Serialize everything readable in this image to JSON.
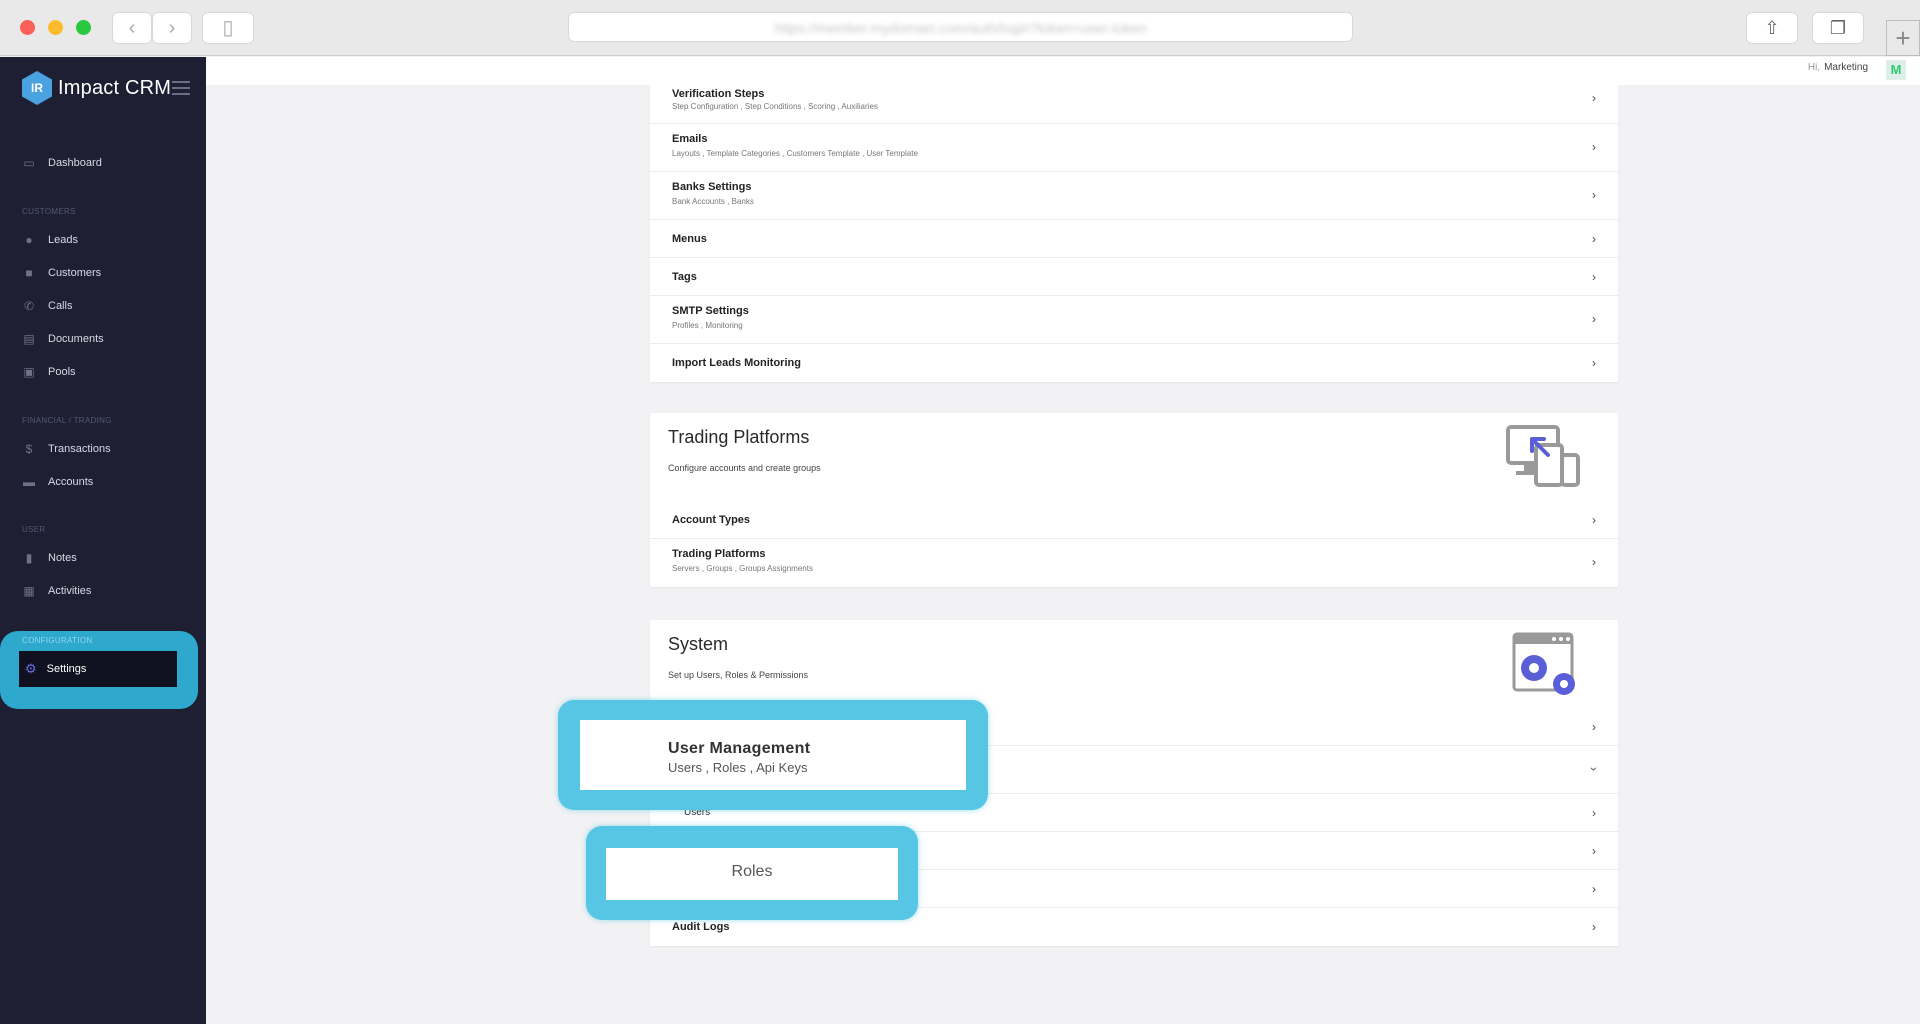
{
  "browser": {
    "url": "https://member.mydomain.com/auth/login?token=user-token"
  },
  "sidebar": {
    "brand": "Impact CRM",
    "logo_letters": "IR",
    "items": [
      {
        "label": "Dashboard",
        "icon": "monitor-icon"
      },
      {
        "label": "Leads",
        "icon": "user-icon"
      },
      {
        "label": "Customers",
        "icon": "contact-card-icon"
      },
      {
        "label": "Calls",
        "icon": "phone-icon"
      },
      {
        "label": "Documents",
        "icon": "inbox-icon"
      },
      {
        "label": "Pools",
        "icon": "briefcase-icon"
      },
      {
        "label": "Transactions",
        "icon": "dollar-icon"
      },
      {
        "label": "Accounts",
        "icon": "wallet-icon"
      },
      {
        "label": "Notes",
        "icon": "clipboard-icon"
      },
      {
        "label": "Activities",
        "icon": "calendar-icon"
      },
      {
        "label": "Settings",
        "icon": "gear-icon"
      }
    ],
    "sections": {
      "customers": "CUSTOMERS",
      "financial": "FINANCIAL / TRADING",
      "user": "USER",
      "configuration": "CONFIGURATION"
    }
  },
  "topbar": {
    "hi": "Hi,",
    "user": "Marketing",
    "avatar": "M"
  },
  "card1": {
    "rows": [
      {
        "title": "Verification Steps",
        "sub": "Step Configuration , Step Conditions , Scoring , Auxiliaries"
      },
      {
        "title": "Emails",
        "sub": "Layouts , Template Categories , Customers Template , User Template"
      },
      {
        "title": "Banks Settings",
        "sub": "Bank Accounts , Banks"
      },
      {
        "title": "Menus",
        "sub": ""
      },
      {
        "title": "Tags",
        "sub": ""
      },
      {
        "title": "SMTP Settings",
        "sub": "Profiles , Monitoring"
      },
      {
        "title": "Import Leads Monitoring",
        "sub": ""
      }
    ]
  },
  "trading": {
    "title": "Trading Platforms",
    "subtitle": "Configure accounts and create groups",
    "rows": [
      {
        "title": "Account Types",
        "sub": ""
      },
      {
        "title": "Trading Platforms",
        "sub": "Servers , Groups , Groups Assignments"
      }
    ]
  },
  "system": {
    "title": "System",
    "subtitle": "Set up Users, Roles & Permissions",
    "rows": [
      {
        "title": "",
        "sub": ""
      },
      {
        "title": "",
        "sub": ""
      },
      {
        "title": "Users",
        "sub": ""
      },
      {
        "title": "",
        "sub": ""
      },
      {
        "title": "",
        "sub": ""
      },
      {
        "title": "Audit Logs",
        "sub": ""
      }
    ]
  },
  "callouts": {
    "user_management_title": "User Management",
    "user_management_sub": "Users , Roles , Api Keys",
    "roles": "Roles"
  },
  "colors": {
    "sidebar_bg": "#1e1f33",
    "highlight": "#57c6e4",
    "accent": "#6b6fe0"
  }
}
